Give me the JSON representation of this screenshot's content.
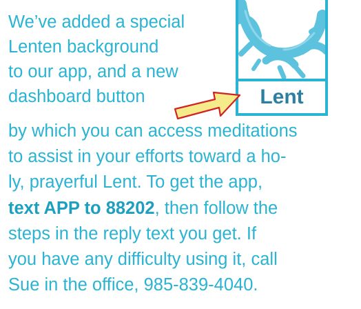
{
  "intro_lines": [
    "We’ve added a special",
    "Lenten background",
    "to our app, and a new",
    "dashboard button"
  ],
  "body_lines": [
    "by which you can access meditations",
    "to assist in your efforts toward a ho-",
    "ly, prayerful Lent.  To get the app,"
  ],
  "sms_instruction": "text APP to 88202",
  "after_sms": ", then follow the",
  "remaining_lines": [
    "steps in the reply text you get.  If",
    "you have any difficulty using it, call",
    "Sue in the office, 985-839-4040."
  ],
  "dashboard_button": {
    "label": "Lent",
    "icon": "crown-of-thorns-icon"
  },
  "colors": {
    "text": "#2ab3d2",
    "accent_text": "#1f9fbf",
    "button_label": "#2d7fa0",
    "arrow_fill": "#f6eb8a",
    "arrow_stroke": "#d12222"
  }
}
